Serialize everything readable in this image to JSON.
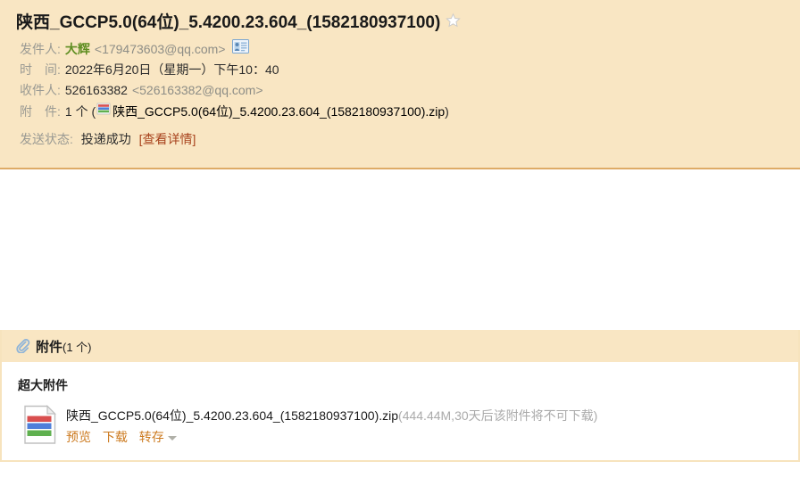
{
  "header": {
    "subject": "陕西_GCCP5.0(64位)_5.4200.23.604_(1582180937100)",
    "star_icon": "star-outline-icon",
    "from": {
      "label": "发件人:",
      "name": "大辉",
      "address": "<179473603@qq.com>",
      "contact_icon": "contact-card-icon"
    },
    "date": {
      "label": "时　间:",
      "value": "2022年6月20日（星期一）下午10：40"
    },
    "to": {
      "label": "收件人:",
      "name": "526163382",
      "address": "<526163382@qq.com>"
    },
    "attachment_line": {
      "label": "附　件:",
      "count": "1 个 (",
      "icon": "zip-file-icon",
      "filename": "陕西_GCCP5.0(64位)_5.4200.23.604_(1582180937100).zip",
      "close": ")"
    },
    "status": {
      "label": "发送状态:",
      "value": "投递成功",
      "detail_link": "[查看详情]"
    }
  },
  "attachments": {
    "panel_icon": "paperclip-icon",
    "panel_title": "附件",
    "panel_count": "(1 个)",
    "section_title": "超大附件",
    "items": [
      {
        "icon": "zip-file-icon",
        "filename": "陕西_GCCP5.0(64位)_5.4200.23.604_(1582180937100).zip",
        "meta": "(444.44M,30天后该附件将不可下载)",
        "actions": [
          "预览",
          "下载",
          "转存"
        ]
      }
    ]
  },
  "colors": {
    "header_bg": "#f9e6c3",
    "header_border": "#deab66",
    "sender_green": "#5f8e22",
    "link_orange": "#cc7a1f",
    "status_link": "#a8431d",
    "label_gray": "#9a9a93",
    "meta_gray": "#aaaaaa"
  }
}
